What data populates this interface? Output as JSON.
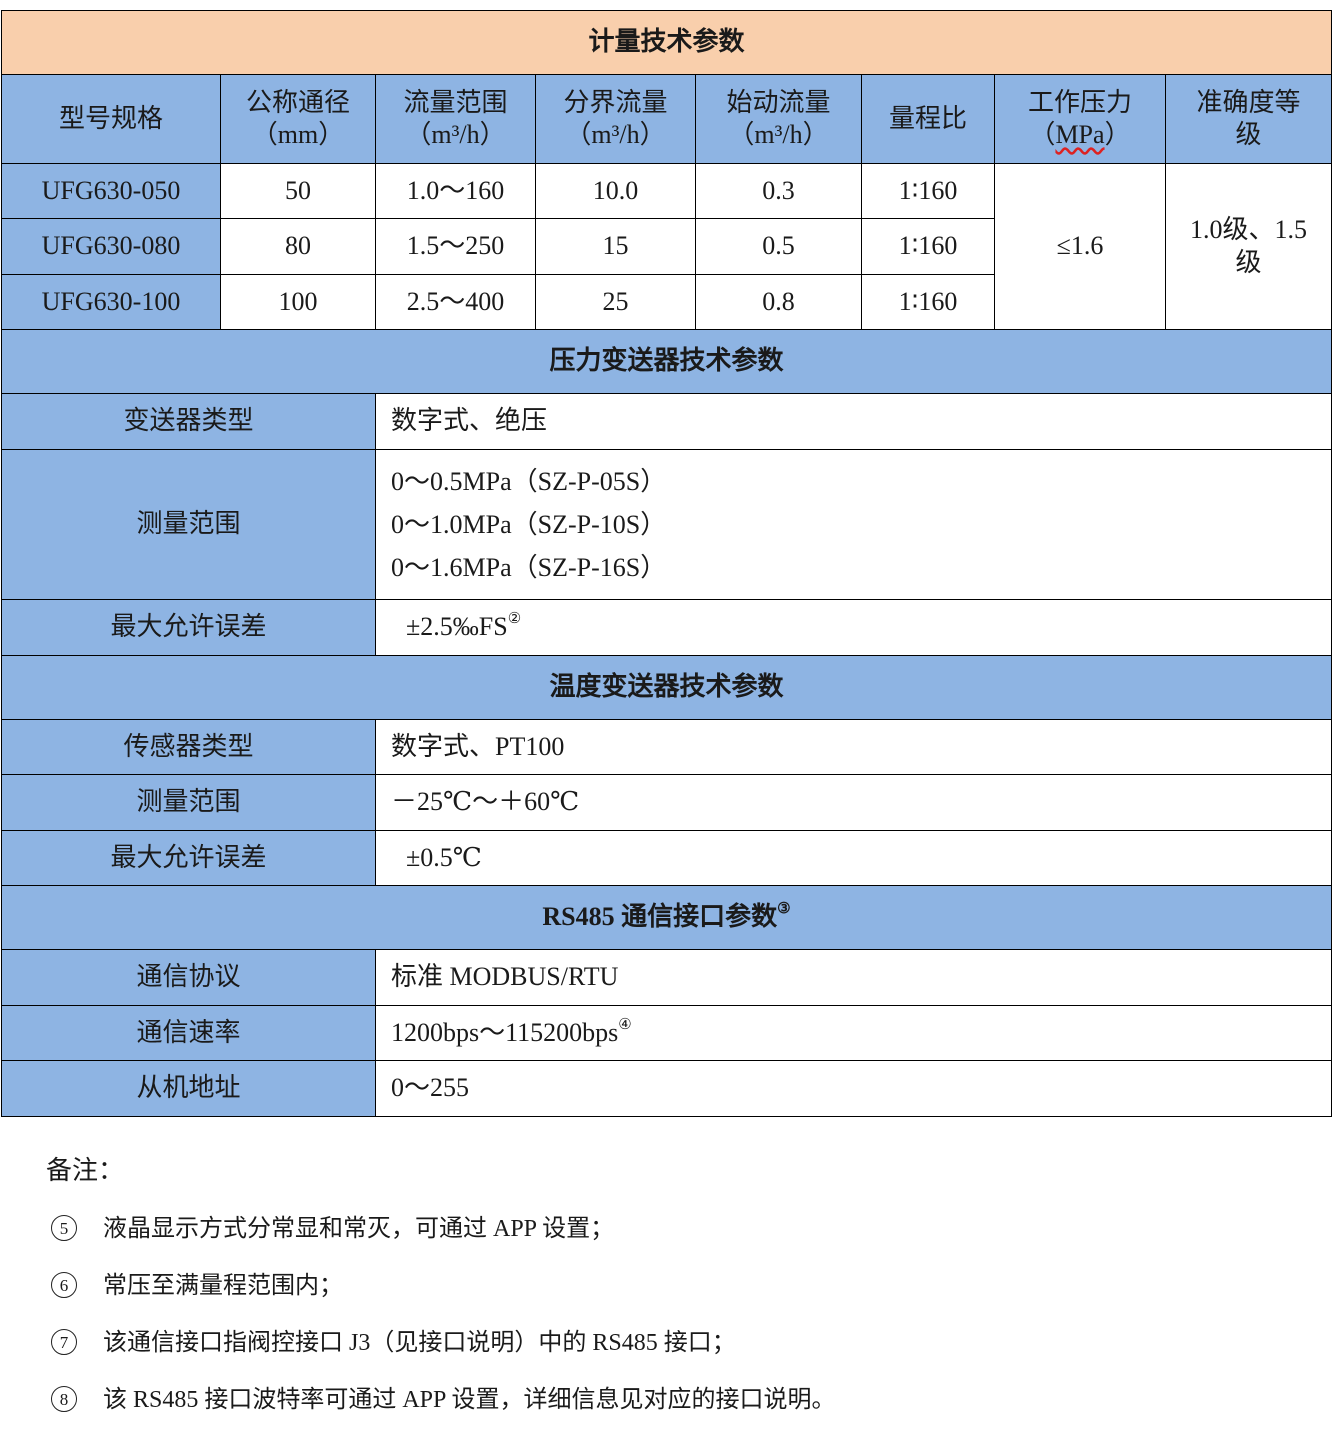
{
  "meter": {
    "title": "计量技术参数",
    "headers": [
      {
        "line1": "型号规格",
        "line2": ""
      },
      {
        "line1": "公称通径",
        "line2": "（mm）"
      },
      {
        "line1": "流量范围",
        "line2": "（m³/h）"
      },
      {
        "line1": "分界流量",
        "line2": "（m³/h）"
      },
      {
        "line1": "始动流量",
        "line2": "（m³/h）"
      },
      {
        "line1": "量程比",
        "line2": ""
      },
      {
        "line1": "工作压力",
        "line2": "（",
        "line2_underlined": "MPa",
        "line2_end": "）"
      },
      {
        "line1": "准确度等",
        "line2": "级"
      }
    ],
    "rows": [
      {
        "model": "UFG630-050",
        "dn": "50",
        "flow": "1.0～160",
        "boundary": "10.0",
        "start": "0.3",
        "ratio": "1∶160"
      },
      {
        "model": "UFG630-080",
        "dn": "80",
        "flow": "1.5～250",
        "boundary": "15",
        "start": "0.5",
        "ratio": "1∶160"
      },
      {
        "model": "UFG630-100",
        "dn": "100",
        "flow": "2.5～400",
        "boundary": "25",
        "start": "0.8",
        "ratio": "1∶160"
      }
    ],
    "pressure": "≤1.6",
    "accuracy_line1": "1.0级、1.5",
    "accuracy_line2": "级"
  },
  "pressure_tx": {
    "title": "压力变送器技术参数",
    "type_label": "变送器类型",
    "type_value": "数字式、绝压",
    "range_label": "测量范围",
    "ranges": [
      "0～0.5MPa（SZ-P-05S）",
      "0～1.0MPa（SZ-P-10S）",
      "0～1.6MPa（SZ-P-16S）"
    ],
    "error_label": "最大允许误差",
    "error_value": "±2.5‰FS",
    "error_mark": "②"
  },
  "temp_tx": {
    "title": "温度变送器技术参数",
    "type_label": "传感器类型",
    "type_value": "数字式、PT100",
    "range_label": "测量范围",
    "range_value": "－25℃～＋60℃",
    "error_label": "最大允许误差",
    "error_value": "±0.5℃"
  },
  "rs485": {
    "title": "RS485 通信接口参数",
    "title_mark": "③",
    "protocol_label": "通信协议",
    "protocol_value": "标准 MODBUS/RTU",
    "rate_label": "通信速率",
    "rate_value": "1200bps～115200bps",
    "rate_mark": "④",
    "address_label": "从机地址",
    "address_value": "0～255"
  },
  "notes": {
    "title": "备注：",
    "items": [
      {
        "num": "5",
        "text": "液晶显示方式分常显和常灭，可通过 APP 设置；"
      },
      {
        "num": "6",
        "text": "常压至满量程范围内；"
      },
      {
        "num": "7",
        "text": "该通信接口指阀控接口 J3（见接口说明）中的 RS485 接口；"
      },
      {
        "num": "8",
        "text": "该 RS485 接口波特率可通过 APP 设置，详细信息见对应的接口说明。"
      }
    ]
  },
  "colors": {
    "section_peach": "#f9cfac",
    "section_blue": "#8eb4e3"
  }
}
